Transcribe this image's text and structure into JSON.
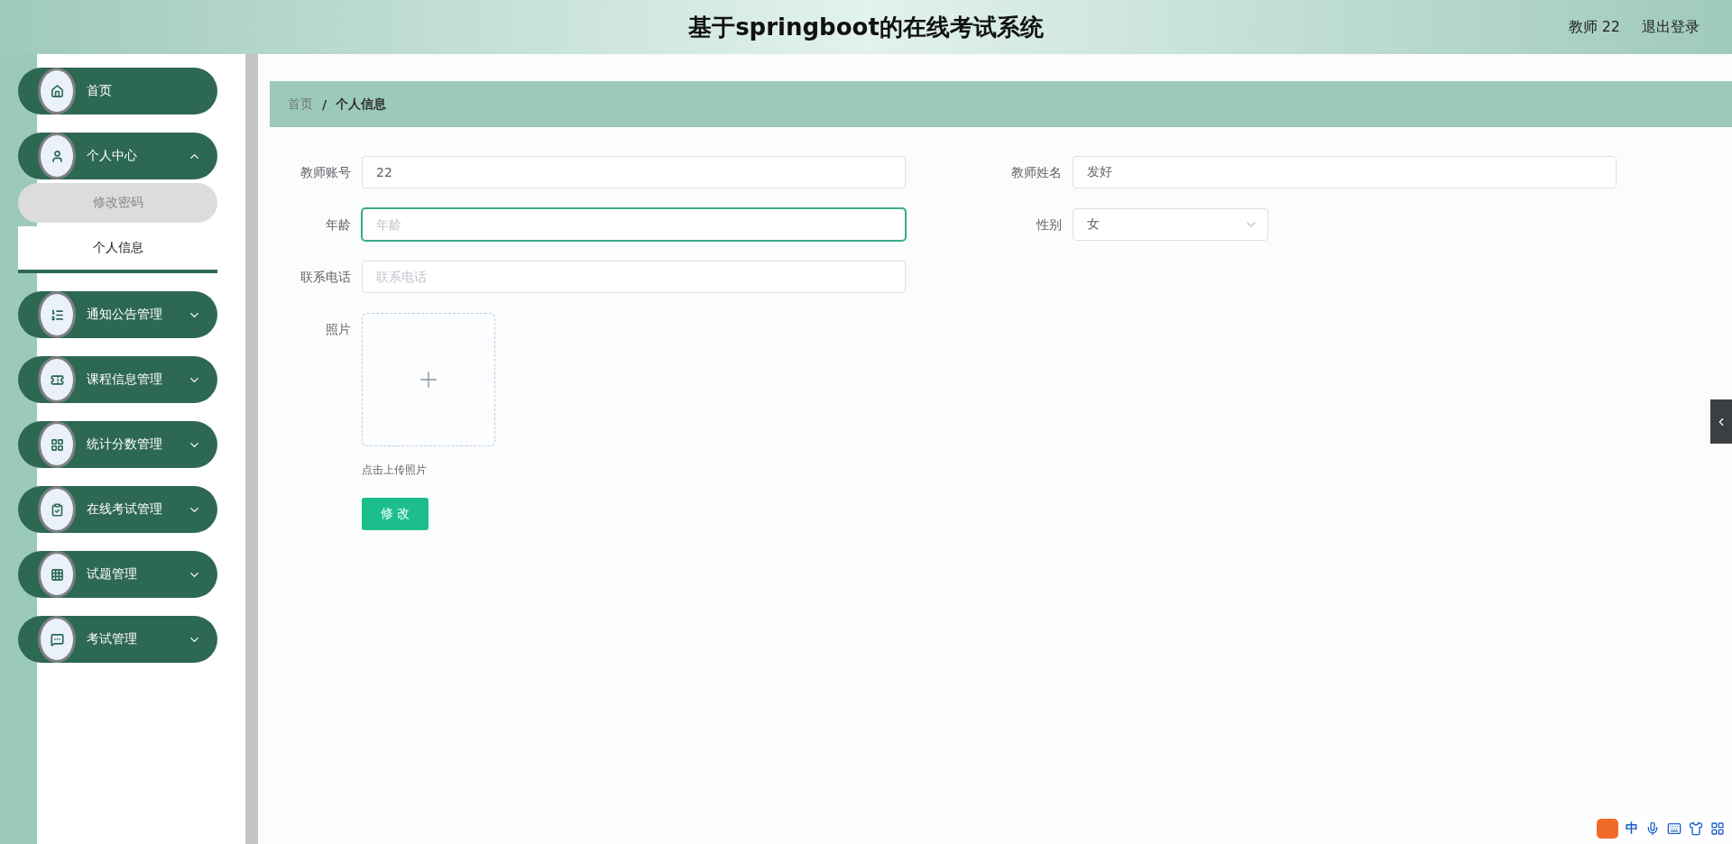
{
  "header": {
    "title": "基于springboot的在线考试系统",
    "user": "教师 22",
    "logout": "退出登录"
  },
  "sidebar": {
    "items": [
      {
        "label": "首页",
        "expandable": false
      },
      {
        "label": "个人中心",
        "expandable": true,
        "expanded": true,
        "children": [
          {
            "label": "修改密码",
            "selected": false,
            "hovered": true
          },
          {
            "label": "个人信息",
            "selected": true,
            "hovered": false
          }
        ]
      },
      {
        "label": "通知公告管理",
        "expandable": true,
        "expanded": false
      },
      {
        "label": "课程信息管理",
        "expandable": true,
        "expanded": false
      },
      {
        "label": "统计分数管理",
        "expandable": true,
        "expanded": false
      },
      {
        "label": "在线考试管理",
        "expandable": true,
        "expanded": false
      },
      {
        "label": "试题管理",
        "expandable": true,
        "expanded": false
      },
      {
        "label": "考试管理",
        "expandable": true,
        "expanded": false
      }
    ]
  },
  "breadcrumb": [
    {
      "label": "首页",
      "current": false
    },
    {
      "label": "个人信息",
      "current": true
    }
  ],
  "breadcrumb_separator": "/",
  "form": {
    "rows": [
      [
        {
          "kind": "text",
          "label": "教师账号",
          "value": "22",
          "focused": false
        },
        {
          "kind": "text",
          "label": "教师姓名",
          "value": "发好",
          "focused": false
        }
      ],
      [
        {
          "kind": "text",
          "label": "年龄",
          "placeholder": "年龄",
          "focused": true
        },
        {
          "kind": "select",
          "label": "性别",
          "value": "女"
        }
      ],
      [
        {
          "kind": "text",
          "label": "联系电话",
          "placeholder": "联系电话",
          "focused": false
        }
      ],
      [
        {
          "kind": "upload",
          "label": "照片",
          "hint": "点击上传照片"
        }
      ]
    ],
    "submit": "修 改"
  },
  "ime_toolbar": {
    "mode": "中"
  }
}
